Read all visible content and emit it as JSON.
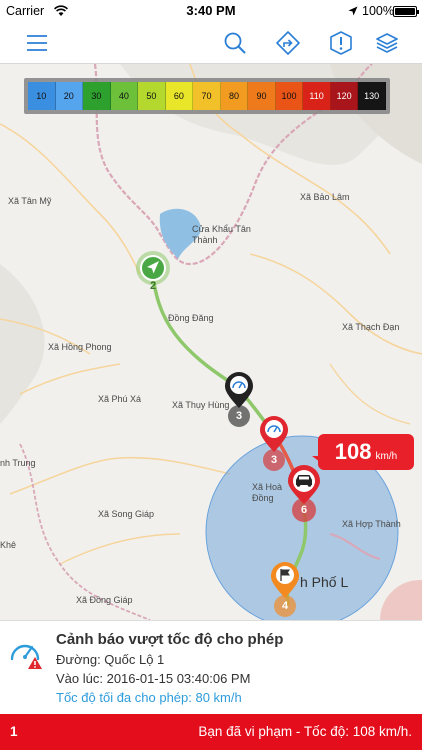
{
  "status_bar": {
    "carrier": "Carrier",
    "time": "3:40 PM",
    "battery_percent": "100%",
    "battery_level": 1.0
  },
  "toolbar": {
    "icons": [
      "menu-icon",
      "search-icon",
      "directions-icon",
      "alert-icon",
      "layers-icon"
    ],
    "accent_color": "#2b7fd6"
  },
  "legend": {
    "speeds": [
      "10",
      "20",
      "30",
      "40",
      "50",
      "60",
      "70",
      "80",
      "90",
      "100",
      "110",
      "120",
      "130"
    ],
    "colors": [
      "#3b8fe0",
      "#55a4ee",
      "#2ea02e",
      "#6cc03a",
      "#b5d82e",
      "#e9e62a",
      "#f2c12a",
      "#f29b21",
      "#ef7a1c",
      "#ea5417",
      "#d92318",
      "#a8151a",
      "#151515"
    ]
  },
  "map": {
    "places": [
      "Xã Tân Mỹ",
      "Xã Bảo Lâm",
      "Cửa Khẩu Tân Thành",
      "Đồng Đăng",
      "Xã Thạch Đạn",
      "Xã Hồng Phong",
      "Xã Phú Xá",
      "Xã Thụy Hùng",
      "Xã Hoà Đồng",
      "Xã Hợp Thành",
      "nh Trung",
      "Xã Song Giáp",
      "Khê",
      "Xã Đồng Giáp",
      "h Phố L"
    ],
    "markers": [
      {
        "icon": "navigation-arrow-icon",
        "label": "2"
      },
      {
        "icon": "speed-camera-icon",
        "label": "3"
      },
      {
        "icon": "speed-warning-icon",
        "label": "3"
      },
      {
        "icon": "car-icon",
        "label": "6"
      },
      {
        "icon": "flag-icon",
        "label": "4"
      }
    ],
    "speed_value": "108",
    "speed_unit": "km/h"
  },
  "info": {
    "title": "Cảnh báo vượt tốc độ cho phép",
    "road": "Đường: Quốc Lộ 1",
    "time": "Vào lúc: 2016-01-15 03:40:06 PM",
    "limit": "Tốc độ tối đa cho phép: 80 km/h"
  },
  "bottom_bar": {
    "count": "1",
    "message": "Bạn đã vi phạm - Tốc độ: 108 km/h."
  }
}
